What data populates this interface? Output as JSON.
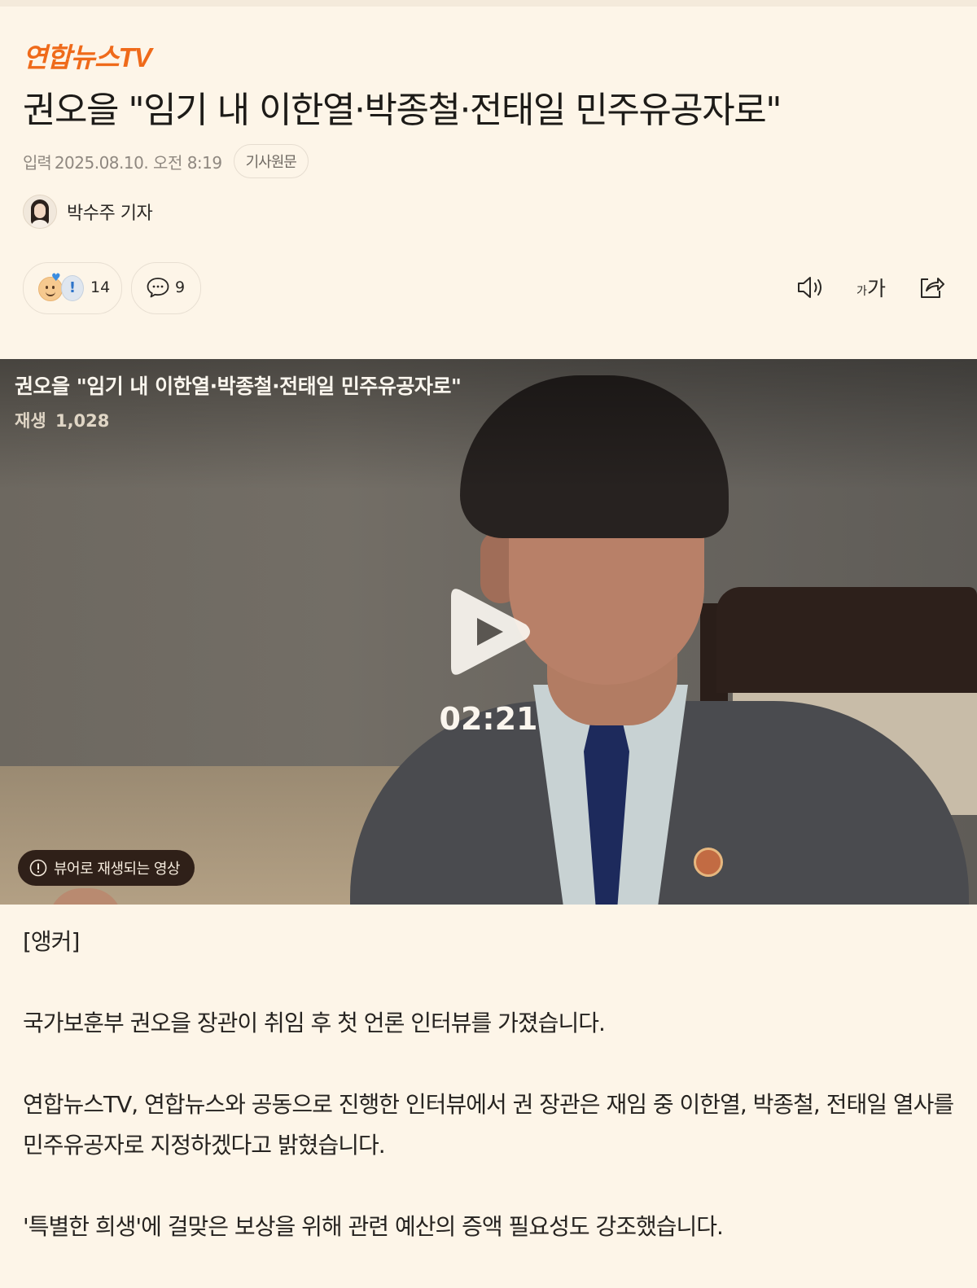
{
  "brand": {
    "logo_text": "연합뉴스TV",
    "accent": "#ef6a1a"
  },
  "article": {
    "headline": "권오을 \"임기 내 이한열·박종철·전태일 민주유공자로\"",
    "meta": {
      "label": "입력",
      "date": "2025.08.10. 오전 8:19",
      "original_button": "기사원문"
    },
    "author": {
      "name": "박수주 기자"
    },
    "reactions": {
      "count": "14",
      "icons": [
        "smile-emoji-icon",
        "heart-icon",
        "exclamation-emoji-icon"
      ]
    },
    "comments": {
      "count": "9",
      "icon": "chat-bubble-icon"
    },
    "tools": {
      "sound_icon": "speaker-icon",
      "font_small": "가",
      "font_big": "가",
      "share_icon": "share-icon"
    }
  },
  "video": {
    "title": "권오을 \"임기 내 이한열·박종철·전태일 민주유공자로\"",
    "plays_label": "재생",
    "plays_count": "1,028",
    "duration": "02:21",
    "notice": "뷰어로 재생되는 영상",
    "play_icon": "play-icon"
  },
  "body": {
    "paragraphs": [
      "[앵커]",
      "국가보훈부 권오을 장관이 취임 후 첫 언론 인터뷰를 가졌습니다.",
      "연합뉴스TV, 연합뉴스와 공동으로 진행한 인터뷰에서 권 장관은 재임 중 이한열, 박종철, 전태일 열사를 민주유공자로 지정하겠다고 밝혔습니다.",
      "'특별한 희생'에 걸맞은 보상을 위해 관련 예산의 증액 필요성도 강조했습니다."
    ]
  }
}
